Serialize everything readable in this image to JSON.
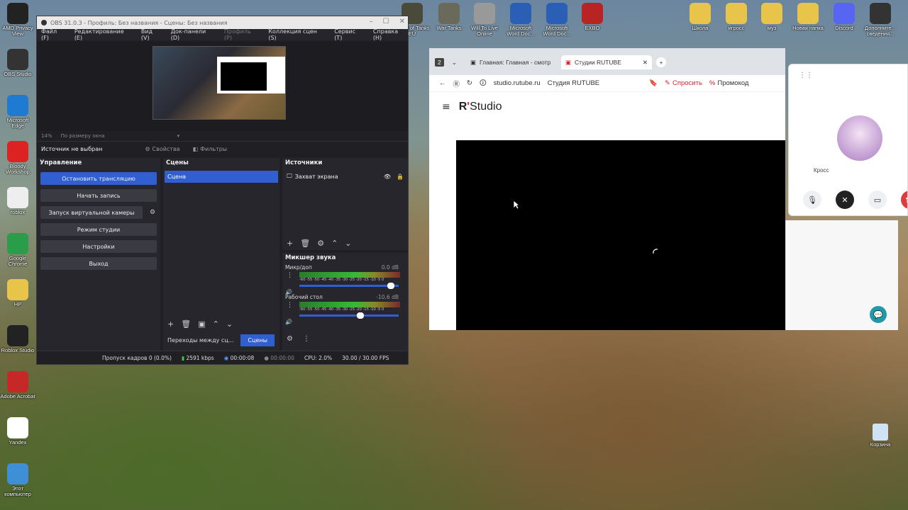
{
  "desktop_left": [
    {
      "label": "AMD Privacy View",
      "color": "#222"
    },
    {
      "label": "OBS Studio",
      "color": "#333"
    },
    {
      "label": "Microsoft Edge",
      "color": "#1f7ad1"
    },
    {
      "label": "Bloody Workshop",
      "color": "#d22"
    },
    {
      "label": "roblox",
      "color": "#eee"
    },
    {
      "label": "Google Chrome",
      "color": "#2a9d4a"
    },
    {
      "label": "HP",
      "color": "#e8c44b"
    },
    {
      "label": "Roblox Studio",
      "color": "#222"
    },
    {
      "label": "Adobe Acrobat",
      "color": "#c62828"
    },
    {
      "label": "Yandex",
      "color": "#fff"
    },
    {
      "label": "Этот компьютер",
      "color": "#3f8fd6"
    }
  ],
  "desktop_top": [
    {
      "label": "World of Tanks EU",
      "color": "#4a4a3a"
    },
    {
      "label": "War Tanks",
      "color": "#6a6a5a"
    },
    {
      "label": "Will To Live Online",
      "color": "#999"
    },
    {
      "label": "Microsoft Word Doc...",
      "color": "#2b5fb5"
    },
    {
      "label": "Microsoft Word Doc...",
      "color": "#2b5fb5"
    },
    {
      "label": "EXBO",
      "color": "#b82424"
    }
  ],
  "desktop_right": [
    {
      "label": "Школа",
      "color": "#e8c44b"
    },
    {
      "label": "игросс",
      "color": "#e8c44b"
    },
    {
      "label": "муз",
      "color": "#e8c44b"
    },
    {
      "label": "Новая папка",
      "color": "#e8c44b"
    },
    {
      "label": "Discord",
      "color": "#5865f2"
    },
    {
      "label": "Дополните... сведения...",
      "color": "#333"
    }
  ],
  "recycle_bin": "Корзина",
  "obs": {
    "title": "OBS 31.0.3 - Профиль: Без названия - Сцены: Без названия",
    "menu": [
      "Файл (F)",
      "Редактирование (E)",
      "Вид (V)",
      "Док-панели (D)",
      "Профиль (P)",
      "Коллекция сцен (S)",
      "Сервис (T)",
      "Справка (H)"
    ],
    "zoom_pct": "14%",
    "zoom_mode": "По размеру окна",
    "no_source": "Источник не выбран",
    "properties": "Свойства",
    "filters": "Фильтры",
    "controls_title": "Управление",
    "controls": [
      "Остановить трансляцию",
      "Начать запись",
      "Запуск виртуальной камеры",
      "Режим студии",
      "Настройки",
      "Выход"
    ],
    "scenes_title": "Сцены",
    "scene_item": "Сцена",
    "sources_title": "Источники",
    "source_item": "Захват экрана",
    "mixer_title": "Микшер звука",
    "mixer": [
      {
        "name": "Микр/доп",
        "db": "0.0 dB",
        "level": 0.2,
        "slider": 0.95
      },
      {
        "name": "Рабочий стол",
        "db": "-10.6 dB",
        "level": 0.45,
        "slider": 0.62
      }
    ],
    "ticks": "-60 -55 -50 -45 -40 -35 -30 -25 -20 -15 -10 -5 0",
    "transitions_tab": "Переходы между сц...",
    "scenes_tab": "Сцены",
    "status": {
      "dropped": "Пропуск кадров 0 (0.0%)",
      "bitrate": "2591 kbps",
      "live_time": "00:00:08",
      "rec_time": "00:00:00",
      "cpu": "CPU: 2.0%",
      "fps": "30.00 / 30.00 FPS"
    }
  },
  "browser": {
    "tab_count": "2",
    "tab1": "Главная: Главная - смотр",
    "tab2": "Студии RUTUBE",
    "url": "studio.rutube.ru",
    "page_title": "Студия RUTUBE",
    "ask": "Спросить",
    "promo": "Промокод",
    "logo_r": "R",
    "logo_studio": "Studio"
  },
  "call": {
    "name": "Кросс"
  }
}
